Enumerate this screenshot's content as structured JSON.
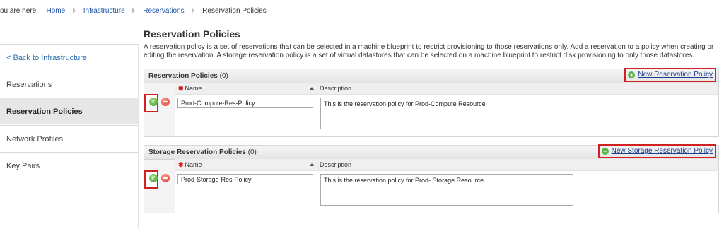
{
  "breadcrumb": {
    "prefix": "ou are here:",
    "items": [
      "Home",
      "Infrastructure",
      "Reservations",
      "Reservation Policies"
    ]
  },
  "sidebar": {
    "back": "< Back to Infrastructure",
    "items": [
      "Reservations",
      "Reservation Policies",
      "Network Profiles",
      "Key Pairs"
    ],
    "active": "Reservation Policies"
  },
  "page": {
    "title": "Reservation Policies",
    "description": "A reservation policy is a set of reservations that can be selected in a machine blueprint to restrict provisioning to those reservations only. Add a reservation to a policy when creating or editing the reservation. A storage reservation policy is a set of virtual datastores that can be selected on a machine blueprint to restrict disk provisioning to only those datastores."
  },
  "reservation_policies": {
    "title": "Reservation Policies",
    "count": "(0)",
    "new_button": "New Reservation Policy",
    "col_name": "Name",
    "col_description": "Description",
    "row": {
      "name": "Prod-Compute-Res-Policy",
      "description": "This is the reservation policy for Prod-Compute Resource"
    }
  },
  "storage_policies": {
    "title": "Storage Reservation Policies",
    "count": "(0)",
    "new_button": "New Storage Reservation Policy",
    "col_name": "Name",
    "col_description": "Description",
    "row": {
      "name": "Prod-Storage-Res-Policy",
      "description": "This is the reservation policy for Prod- Storage Resource"
    }
  },
  "icons": {
    "ok": "check-circle-icon",
    "cancel": "minus-circle-icon",
    "add": "plus-circle-icon"
  },
  "colors": {
    "link": "#2255aa",
    "highlight": "#d02020",
    "ok_green": "#3f9a2a",
    "cancel_red": "#d8382b"
  }
}
